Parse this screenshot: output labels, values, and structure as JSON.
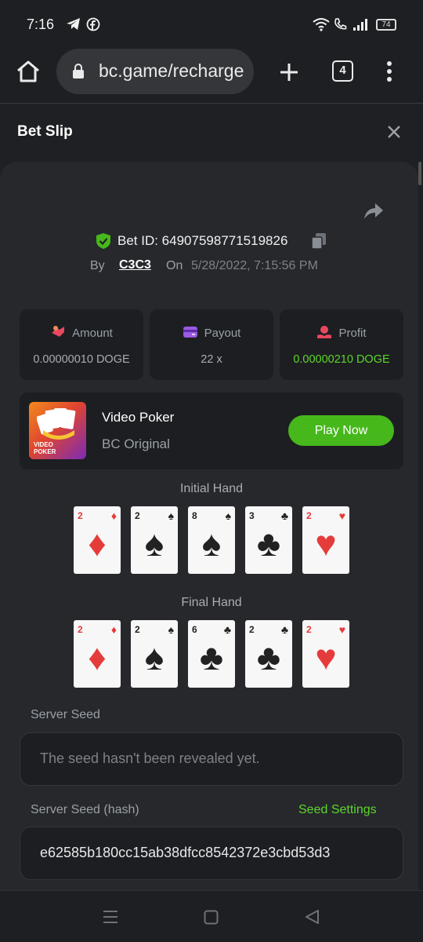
{
  "status_bar": {
    "time": "7:16",
    "battery": "74"
  },
  "browser": {
    "url": "bc.game/recharge",
    "tab_count": "4"
  },
  "slip": {
    "title": "Bet Slip"
  },
  "bet": {
    "id_label": "Bet ID: 64907598771519826",
    "by": "By",
    "user": "C3C3",
    "on": "On",
    "date": "5/28/2022, 7:15:56 PM"
  },
  "stats": [
    {
      "label": "Amount",
      "value": "0.00000010 DOGE"
    },
    {
      "label": "Payout",
      "value": "22 x"
    },
    {
      "label": "Profit",
      "value": "0.00000210 DOGE"
    }
  ],
  "game": {
    "thumb_text_top": "VIDEO",
    "thumb_text_bottom": "POKER",
    "name": "Video Poker",
    "provider": "BC Original",
    "play_label": "Play Now"
  },
  "initial_hand": {
    "title": "Initial Hand",
    "cards": [
      {
        "rank": "2",
        "suit": "♦"
      },
      {
        "rank": "2",
        "suit": "♠"
      },
      {
        "rank": "8",
        "suit": "♠"
      },
      {
        "rank": "3",
        "suit": "♣"
      },
      {
        "rank": "2",
        "suit": "♥"
      }
    ]
  },
  "final_hand": {
    "title": "Final Hand",
    "cards": [
      {
        "rank": "2",
        "suit": "♦"
      },
      {
        "rank": "2",
        "suit": "♠"
      },
      {
        "rank": "6",
        "suit": "♣"
      },
      {
        "rank": "2",
        "suit": "♣"
      },
      {
        "rank": "2",
        "suit": "♥"
      }
    ]
  },
  "seeds": {
    "server_seed_label": "Server Seed",
    "server_seed_value": "The seed hasn't been revealed yet.",
    "server_hash_label": "Server Seed (hash)",
    "seed_settings_label": "Seed Settings",
    "server_hash_value": "e62585b180cc15ab38dfcc8542372e3cbd53d3"
  },
  "colors": {
    "accent_green": "#46b81b",
    "profit_green": "#5ed62a",
    "panel": "#26282c"
  }
}
